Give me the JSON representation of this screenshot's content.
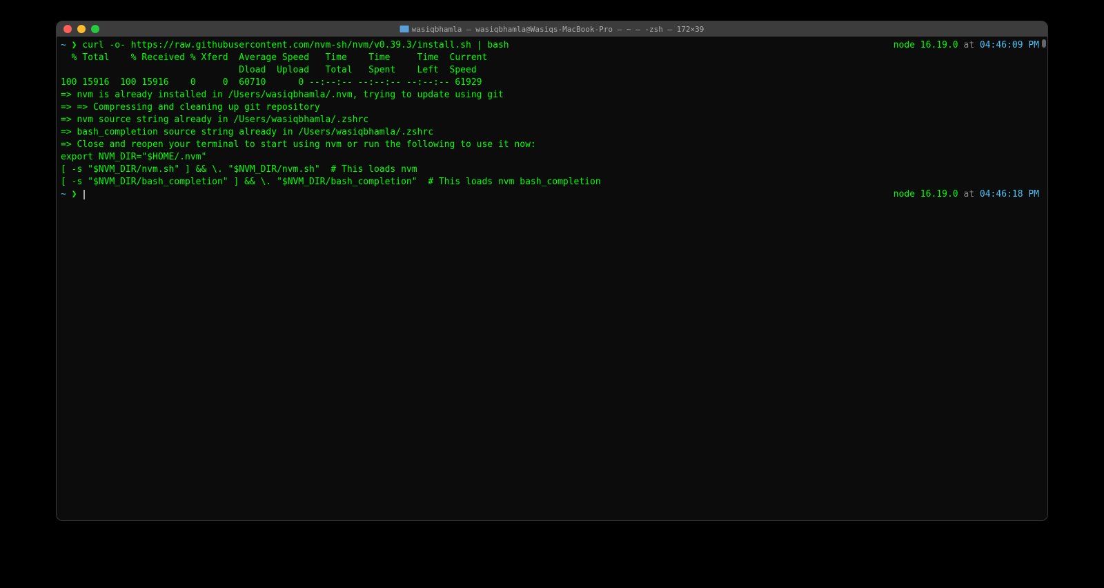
{
  "window": {
    "title": "wasiqbhamla — wasiqbhamla@Wasiqs-MacBook-Pro — ~ — -zsh — 172×39"
  },
  "prompt1": {
    "tilde": "~",
    "chevron": " ❯ ",
    "cmd": "curl -o- https://raw.githubusercontent.com/nvm-sh/nvm/v0.39.3/install.sh | bash",
    "status_node": "node 16.19.0",
    "status_at": " at ",
    "status_time": "04:46:09 PM"
  },
  "output": {
    "l1": "  % Total    % Received % Xferd  Average Speed   Time    Time     Time  Current",
    "l2": "                                 Dload  Upload   Total   Spent    Left  Speed",
    "l3": "100 15916  100 15916    0     0  60710      0 --:--:-- --:--:-- --:--:-- 61929",
    "l4": "=> nvm is already installed in /Users/wasiqbhamla/.nvm, trying to update using git",
    "l5": "=> => Compressing and cleaning up git repository",
    "l6": "",
    "l7": "=> nvm source string already in /Users/wasiqbhamla/.zshrc",
    "l8": "=> bash_completion source string already in /Users/wasiqbhamla/.zshrc",
    "l9": "=> Close and reopen your terminal to start using nvm or run the following to use it now:",
    "l10": "",
    "l11": "export NVM_DIR=\"$HOME/.nvm\"",
    "l12": "[ -s \"$NVM_DIR/nvm.sh\" ] && \\. \"$NVM_DIR/nvm.sh\"  # This loads nvm",
    "l13": "[ -s \"$NVM_DIR/bash_completion\" ] && \\. \"$NVM_DIR/bash_completion\"  # This loads nvm bash_completion"
  },
  "prompt2": {
    "tilde": "~",
    "chevron": " ❯ ",
    "status_node": "node 16.19.0",
    "status_at": " at ",
    "status_time": "04:46:18 PM"
  }
}
